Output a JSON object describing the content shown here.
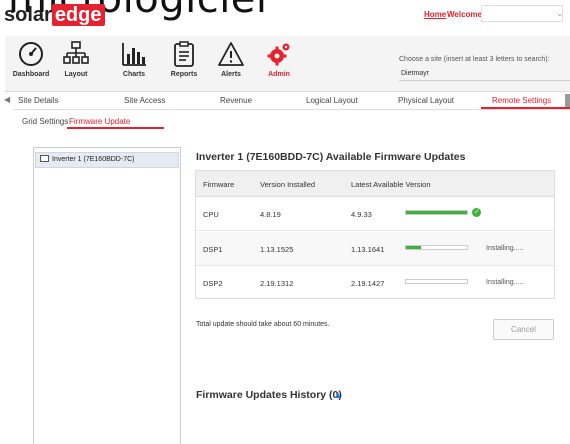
{
  "overlay_title": "microloglciel",
  "header": {
    "logo_solar": "solar",
    "logo_edge": "edge",
    "home_label": "Home",
    "welcome_label": "Welcome",
    "user_value": ""
  },
  "toolbar": {
    "items": [
      {
        "label": "Dashboard",
        "icon": "dashboard-gauge-icon"
      },
      {
        "label": "Layout",
        "icon": "layout-tree-icon"
      },
      {
        "label": "Charts",
        "icon": "charts-icon"
      },
      {
        "label": "Reports",
        "icon": "reports-icon"
      },
      {
        "label": "Alerts",
        "icon": "alert-triangle-icon"
      },
      {
        "label": "Admin",
        "icon": "admin-gears-icon",
        "active": true
      }
    ],
    "site_hint": "Choose a site (insert at least 3 letters to search):",
    "site_value": "Dietmayr"
  },
  "tabs": [
    {
      "label": "Site Details"
    },
    {
      "label": "Site Access"
    },
    {
      "label": "Revenue"
    },
    {
      "label": "Logical Layout"
    },
    {
      "label": "Physical Layout"
    },
    {
      "label": "Remote Settings",
      "active": true
    }
  ],
  "subtabs": [
    {
      "label": "Grid Settings"
    },
    {
      "label": "Firmware Update",
      "active": true
    }
  ],
  "left_panel": {
    "inverter_label": "Inverter 1 (7E160BDD-7C)"
  },
  "firmware": {
    "title": "Inverter 1 (7E160BDD-7C) Available Firmware Updates",
    "columns": [
      "Firmware",
      "Version Installed",
      "Latest Available Version"
    ],
    "rows": [
      {
        "name": "CPU",
        "installed": "4.8.19",
        "latest": "4.9.33",
        "progress": 1.0,
        "status": "",
        "done": true
      },
      {
        "name": "DSP1",
        "installed": "1.13.1525",
        "latest": "1.13.1641",
        "progress": 0.25,
        "status": "Installing....."
      },
      {
        "name": "DSP2",
        "installed": "2.19.1312",
        "latest": "2.19.1427",
        "progress": 0.0,
        "status": "Installing....."
      }
    ],
    "total_note": "Total update should take about 60 minutes.",
    "cancel_label": "Cancel"
  },
  "history": {
    "title": "Firmware Updates History (0)"
  },
  "colors": {
    "brand_red": "#e8212e",
    "progress_green": "#3bb23b",
    "link_blue": "#2b7bd6"
  }
}
